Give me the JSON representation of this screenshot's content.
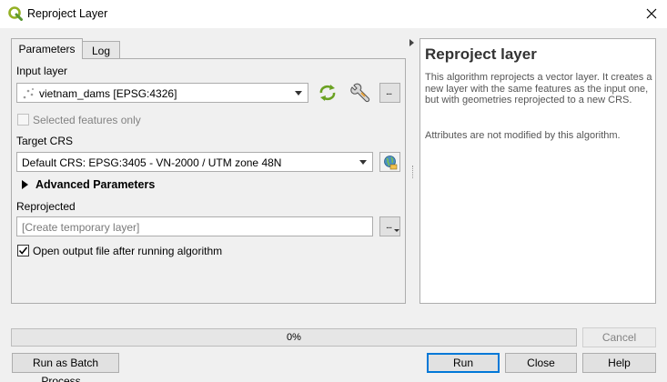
{
  "window": {
    "title": "Reproject Layer",
    "app_icon": "qgis-icon",
    "close_icon": "close-icon"
  },
  "tabs": [
    {
      "label": "Parameters"
    },
    {
      "label": "Log"
    }
  ],
  "params": {
    "input_layer_label": "Input layer",
    "input_layer_value": "vietnam_dams [EPSG:4326]",
    "selected_only_label": "Selected features only",
    "target_crs_label": "Target CRS",
    "target_crs_value": "Default CRS: EPSG:3405 - VN-2000 / UTM zone 48N",
    "advanced_label": "Advanced Parameters",
    "reprojected_label": "Reprojected",
    "reprojected_placeholder": "[Create temporary layer]",
    "open_output_label": "Open output file after running algorithm",
    "ellipsis": "..."
  },
  "help": {
    "title": "Reproject layer",
    "description": "This algorithm reprojects a vector layer. It creates a new layer with the same features as the input one, but with geometries reprojected to a new CRS.",
    "note": "Attributes are not modified by this algorithm."
  },
  "progress": {
    "value": 0,
    "label": "0%"
  },
  "buttons": {
    "cancel": "Cancel",
    "batch": "Run as Batch Process...",
    "run": "Run",
    "close": "Close",
    "help": "Help"
  },
  "colors": {
    "accent": "#0078d7",
    "qgis_green": "#93b023"
  }
}
